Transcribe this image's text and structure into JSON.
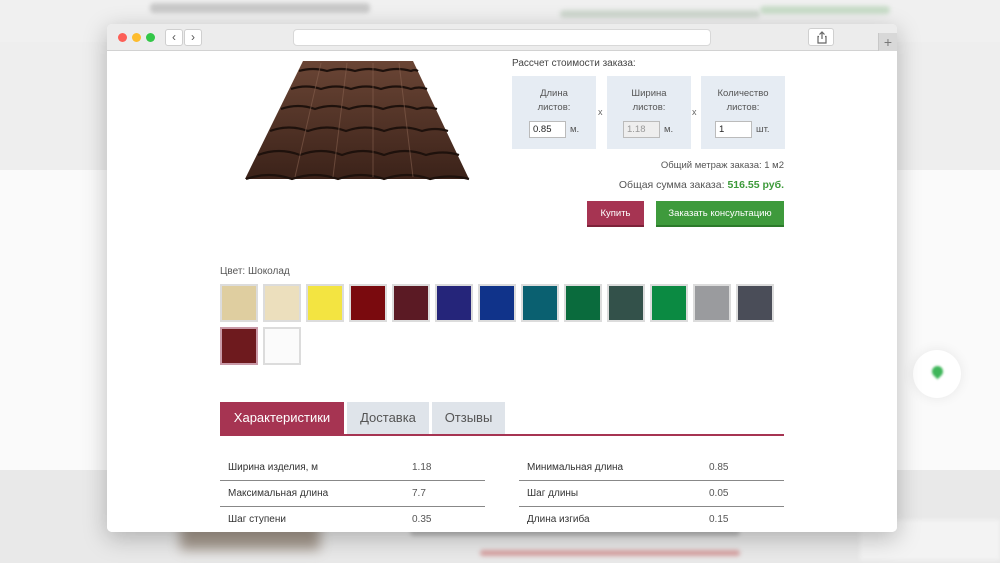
{
  "calculator": {
    "title": "Рассчет стоимости заказа:",
    "length": {
      "label_line1": "Длина",
      "label_line2": "листов:",
      "value": "0.85",
      "unit": "м."
    },
    "width": {
      "label_line1": "Ширина",
      "label_line2": "листов:",
      "value": "1.18",
      "unit": "м."
    },
    "quantity": {
      "label_line1": "Количество",
      "label_line2": "листов:",
      "value": "1",
      "unit": "шт."
    },
    "multiply_sign": "x",
    "total_area": "Общий метраж заказа: 1 м2",
    "total_sum_label": "Общая сумма заказа:",
    "total_sum_value": "516.55 руб.",
    "buy_button": "Купить",
    "consult_button": "Заказать консультацию"
  },
  "colors": {
    "label": "Цвет: Шоколад",
    "swatches": [
      "#dfcea0",
      "#ecdfbd",
      "#f3e441",
      "#7a0a0e",
      "#5b1a24",
      "#25257a",
      "#10338a",
      "#0a6070",
      "#0a6b3d",
      "#33514a",
      "#0b8a42",
      "#9a9b9e",
      "#4a4d58",
      "#6e1a1e",
      "#fbfbfb"
    ],
    "selected_index": 13
  },
  "tabs": [
    {
      "label": "Характеристики",
      "active": true
    },
    {
      "label": "Доставка",
      "active": false
    },
    {
      "label": "Отзывы",
      "active": false
    }
  ],
  "specs_left": [
    {
      "name": "Ширина изделия, м",
      "value": "1.18"
    },
    {
      "name": "Максимальная длина",
      "value": "7.7"
    },
    {
      "name": "Шаг ступени",
      "value": "0.35"
    }
  ],
  "specs_right": [
    {
      "name": "Минимальная длина",
      "value": "0.85"
    },
    {
      "name": "Шаг длины",
      "value": "0.05"
    },
    {
      "name": "Длина изгиба",
      "value": "0.15"
    }
  ],
  "accent_colors": {
    "primary": "#a63452",
    "success": "#3e9a3c",
    "price": "#3d9a3a"
  }
}
